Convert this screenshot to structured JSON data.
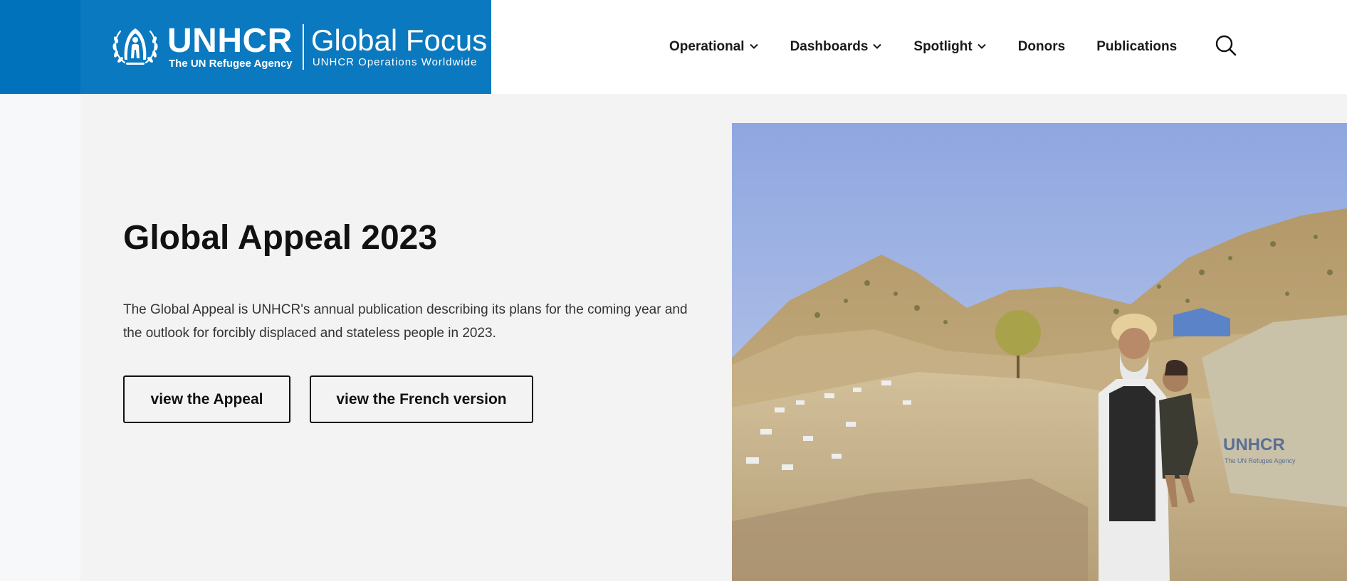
{
  "brand": {
    "org_name": "UNHCR",
    "org_tagline": "The UN Refugee Agency",
    "site_title": "Global Focus",
    "site_subtitle": "UNHCR Operations Worldwide",
    "color_primary": "#0072bc"
  },
  "nav": {
    "items": [
      {
        "label": "Operational",
        "has_dropdown": true,
        "icon": "chevron-down-icon"
      },
      {
        "label": "Dashboards",
        "has_dropdown": true,
        "icon": "chevron-down-icon"
      },
      {
        "label": "Spotlight",
        "has_dropdown": true,
        "icon": "chevron-down-icon"
      },
      {
        "label": "Donors",
        "has_dropdown": false
      },
      {
        "label": "Publications",
        "has_dropdown": false
      }
    ],
    "search_icon": "search-icon"
  },
  "hero": {
    "title": "Global Appeal 2023",
    "description": "The Global Appeal is UNHCR's annual publication describing its plans for the coming year and the outlook for forcibly displaced and stateless people in 2023.",
    "buttons": {
      "appeal_label": "view the Appeal",
      "french_label": "view the French version"
    },
    "photo": {
      "tent_print_name": "UNHCR",
      "tent_print_tagline": "The UN Refugee Agency"
    }
  }
}
